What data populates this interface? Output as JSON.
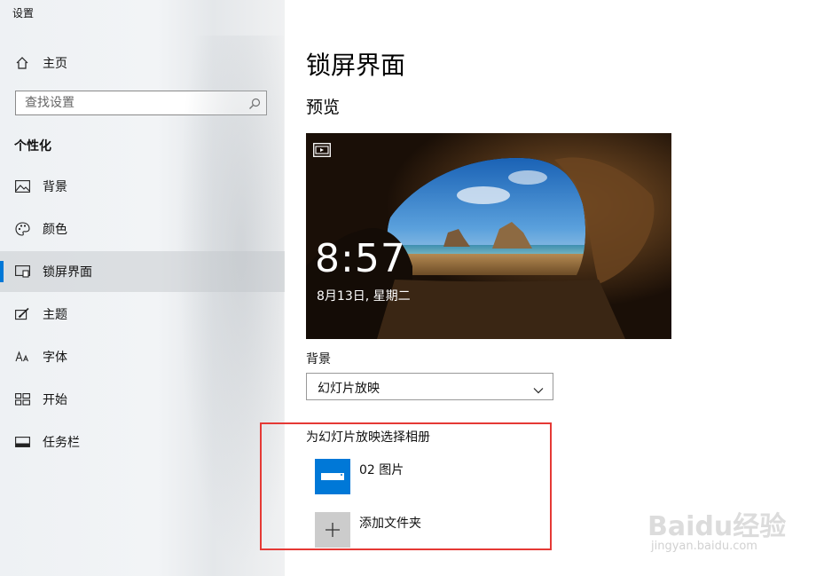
{
  "window": {
    "title": "设置"
  },
  "sidebar": {
    "home_label": "主页",
    "search_placeholder": "查找设置",
    "section_title": "个性化",
    "items": [
      {
        "label": "背景",
        "icon": "picture-icon"
      },
      {
        "label": "颜色",
        "icon": "palette-icon"
      },
      {
        "label": "锁屏界面",
        "icon": "lock-screen-icon",
        "selected": true
      },
      {
        "label": "主题",
        "icon": "theme-brush-icon"
      },
      {
        "label": "字体",
        "icon": "font-icon"
      },
      {
        "label": "开始",
        "icon": "start-grid-icon"
      },
      {
        "label": "任务栏",
        "icon": "taskbar-icon"
      }
    ]
  },
  "main": {
    "title": "锁屏界面",
    "preview_label": "预览",
    "preview": {
      "time": "8:57",
      "date": "8月13日, 星期二"
    },
    "background_label": "背景",
    "background_value": "幻灯片放映",
    "album_label": "为幻灯片放映选择相册",
    "albums": [
      {
        "name": "02 图片"
      }
    ],
    "add_folder_label": "添加文件夹"
  },
  "watermark": {
    "logo": "Baidu经验",
    "url": "jingyan.baidu.com"
  },
  "colors": {
    "accent": "#0078d7",
    "highlight_box": "#e53935",
    "add_tile": "#cccccc"
  }
}
